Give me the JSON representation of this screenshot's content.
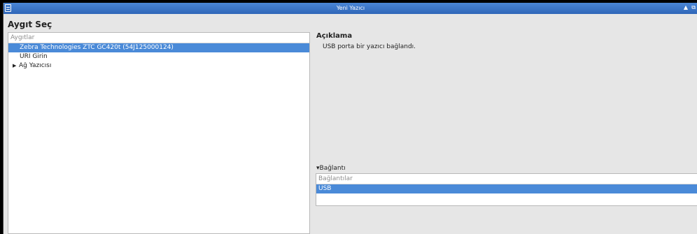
{
  "window": {
    "title": "Yeni Yazıcı",
    "controls": {
      "up_arrow": "▲",
      "restore": "⧉"
    }
  },
  "heading": "Aygıt Seç",
  "devices": {
    "column_header": "Aygıtlar",
    "items": [
      {
        "label": "Zebra Technologies ZTC GC420t (54J125000124)",
        "selected": true
      },
      {
        "label": "URI Girin",
        "selected": false
      },
      {
        "label": "Ağ Yazıcısı",
        "selected": false,
        "expander": "▶"
      }
    ]
  },
  "description": {
    "title": "Açıklama",
    "text": "USB porta bir yazıcı bağlandı."
  },
  "connection": {
    "expander_label": "▾Bağlantı",
    "column_header": "Bağlantılar",
    "items": [
      {
        "label": "USB",
        "selected": true
      }
    ]
  },
  "colors": {
    "titlebar": "#2f66b8",
    "selection": "#4a8ad8",
    "background": "#e6e6e6"
  }
}
